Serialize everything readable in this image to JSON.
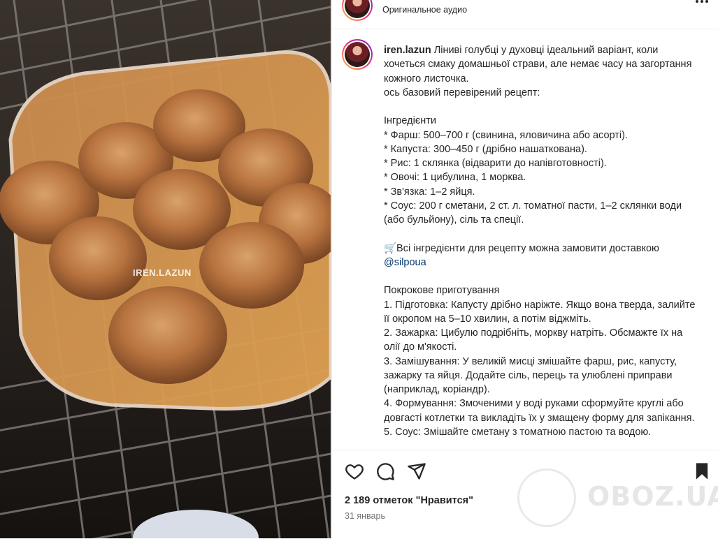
{
  "header": {
    "audio_label": "Оригинальное аудио",
    "more_icon": "more-horizontal-icon"
  },
  "media": {
    "watermark": "IREN.LAZUN"
  },
  "caption": {
    "username": "iren.lazun",
    "part1": " Ліниві голубці у духовці ідеальний варіант, коли хочеться смаку домашньої страви, але немає часу на загортання кожного листочка.\nось базовий перевірений рецепт:\n\nІнгредієнти\n* Фарш: 500–700 г (свинина, яловичина або асорті).\n* Капуста: 300–450 г (дрібно нашаткована).\n* Рис: 1 склянка (відварити до напівготовності).\n* Овочі: 1 цибулина, 1 морква.\n* Зв'язка: 1–2 яйця.\n* Соус: 200 г сметани, 2 ст. л. томатної пасти, 1–2 склянки води (або бульйону), сіль та спеції.\n\n🛒Всі інгредієнти для рецепту можна замовити доставкою\n",
    "mention": "@silpoua",
    "part2": "\n\nПокрокове приготування\n1. Підготовка: Капусту дрібно наріжте. Якщо вона тверда, залийте її окропом на 5–10 хвилин, а потім віджміть.\n2. Зажарка: Цибулю подрібніть, моркву натріть. Обсмажте їх на олії до м'якості.\n3. Замішування: У великій мисці змішайте фарш, рис, капусту, зажарку та яйця. Додайте сіль, перець та улюблені приправи (наприклад, коріандр).\n4. Формування: Змоченими у воді руками сформуйте круглі або довгасті котлетки та викладіть їх у змащену форму для запікання.\n5. Соус: Змішайте сметану з томатною пастою та водою."
  },
  "actions": {
    "like_icon": "heart-icon",
    "comment_icon": "comment-icon",
    "share_icon": "send-icon",
    "save_icon": "bookmark-icon",
    "likes_text": "2 189 отметок \"Нравится\"",
    "date": "31 январь"
  },
  "watermark_brand": {
    "text": "OBOZ.UA"
  }
}
